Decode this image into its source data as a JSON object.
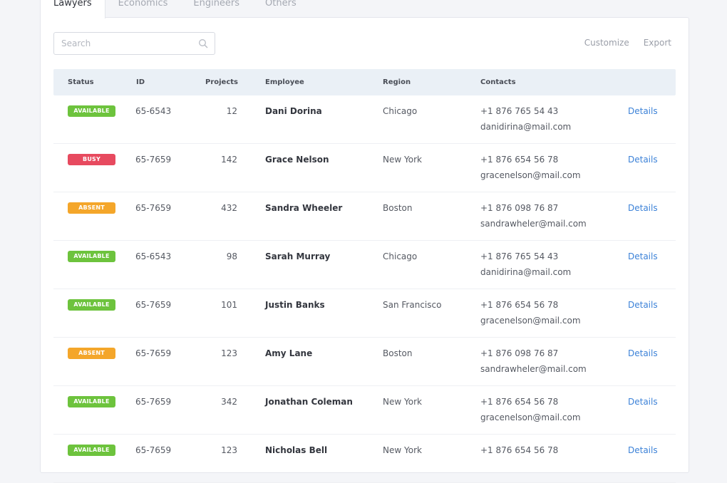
{
  "tabs": [
    {
      "label": "Lawyers",
      "active": true
    },
    {
      "label": "Economics",
      "active": false
    },
    {
      "label": "Engineers",
      "active": false
    },
    {
      "label": "Others",
      "active": false
    }
  ],
  "search": {
    "placeholder": "Search",
    "value": "",
    "icon": "search-icon"
  },
  "toolbar": {
    "customize_label": "Customize",
    "export_label": "Export"
  },
  "table": {
    "headers": {
      "status": "Status",
      "id": "ID",
      "projects": "Projects",
      "employee": "Employee",
      "region": "Region",
      "contacts": "Contacts"
    },
    "status_colors": {
      "AVAILABLE": "#6dc33d",
      "BUSY": "#e74a5f",
      "ABSENT": "#f4a62a"
    },
    "accent_color": "#3c82d8",
    "header_background": "#eaf0f6",
    "rows": [
      {
        "status": "AVAILABLE",
        "id": "65-6543",
        "projects": "12",
        "employee": "Dani Dorina",
        "region": "Chicago",
        "phone": "+1 876 765 54 43",
        "email": "danidirina@mail.com",
        "action": "Details"
      },
      {
        "status": "BUSY",
        "id": "65-7659",
        "projects": "142",
        "employee": "Grace Nelson",
        "region": "New York",
        "phone": "+1 876 654 56 78",
        "email": "gracenelson@mail.com",
        "action": "Details"
      },
      {
        "status": "ABSENT",
        "id": "65-7659",
        "projects": "432",
        "employee": "Sandra Wheeler",
        "region": "Boston",
        "phone": "+1 876 098 76 87",
        "email": "sandrawheler@mail.com",
        "action": "Details"
      },
      {
        "status": "AVAILABLE",
        "id": "65-6543",
        "projects": "98",
        "employee": "Sarah Murray",
        "region": "Chicago",
        "phone": "+1 876 765 54 43",
        "email": "danidirina@mail.com",
        "action": "Details"
      },
      {
        "status": "AVAILABLE",
        "id": "65-7659",
        "projects": "101",
        "employee": "Justin Banks",
        "region": "San Francisco",
        "phone": "+1 876 654 56 78",
        "email": "gracenelson@mail.com",
        "action": "Details"
      },
      {
        "status": "ABSENT",
        "id": "65-7659",
        "projects": "123",
        "employee": "Amy Lane",
        "region": "Boston",
        "phone": "+1 876 098 76 87",
        "email": "sandrawheler@mail.com",
        "action": "Details"
      },
      {
        "status": "AVAILABLE",
        "id": "65-7659",
        "projects": "342",
        "employee": "Jonathan Coleman",
        "region": "New York",
        "phone": "+1 876 654 56 78",
        "email": "gracenelson@mail.com",
        "action": "Details"
      },
      {
        "status": "AVAILABLE",
        "id": "65-7659",
        "projects": "123",
        "employee": "Nicholas Bell",
        "region": "New York",
        "phone": "+1 876 654 56 78",
        "email": "",
        "action": "Details"
      }
    ]
  }
}
